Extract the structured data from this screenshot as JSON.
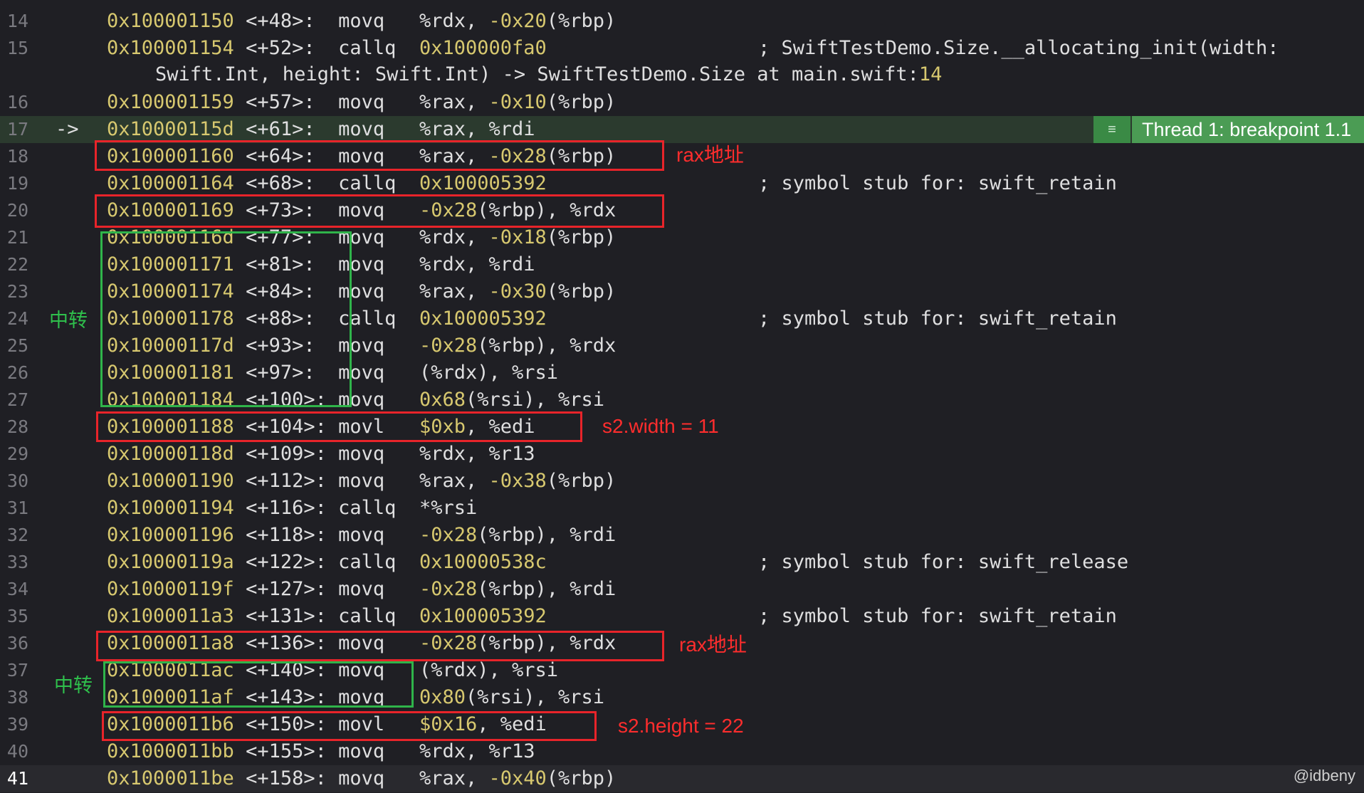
{
  "lines": [
    {
      "n": "14",
      "addr": "0x100001150",
      "off": "<+48>:",
      "op": "movq",
      "args": "%rdx, -0x20(%rbp)",
      "comment": ""
    },
    {
      "n": "15",
      "addr": "0x100001154",
      "off": "<+52>:",
      "op": "callq",
      "args": "0x100000fa0",
      "comment": "; SwiftTestDemo.Size.__allocating_init(width:"
    },
    {
      "n": "16",
      "addr": "0x100001159",
      "off": "<+57>:",
      "op": "movq",
      "args": "%rax, -0x10(%rbp)",
      "comment": ""
    },
    {
      "n": "17",
      "addr": "0x10000115d",
      "off": "<+61>:",
      "op": "movq",
      "args": "%rax, %rdi",
      "comment": ""
    },
    {
      "n": "18",
      "addr": "0x100001160",
      "off": "<+64>:",
      "op": "movq",
      "args": "%rax, -0x28(%rbp)",
      "comment": ""
    },
    {
      "n": "19",
      "addr": "0x100001164",
      "off": "<+68>:",
      "op": "callq",
      "args": "0x100005392",
      "comment": "; symbol stub for: swift_retain"
    },
    {
      "n": "20",
      "addr": "0x100001169",
      "off": "<+73>:",
      "op": "movq",
      "args": "-0x28(%rbp), %rdx",
      "comment": ""
    },
    {
      "n": "21",
      "addr": "0x10000116d",
      "off": "<+77>:",
      "op": "movq",
      "args": "%rdx, -0x18(%rbp)",
      "comment": ""
    },
    {
      "n": "22",
      "addr": "0x100001171",
      "off": "<+81>:",
      "op": "movq",
      "args": "%rdx, %rdi",
      "comment": ""
    },
    {
      "n": "23",
      "addr": "0x100001174",
      "off": "<+84>:",
      "op": "movq",
      "args": "%rax, -0x30(%rbp)",
      "comment": ""
    },
    {
      "n": "24",
      "addr": "0x100001178",
      "off": "<+88>:",
      "op": "callq",
      "args": "0x100005392",
      "comment": "; symbol stub for: swift_retain"
    },
    {
      "n": "25",
      "addr": "0x10000117d",
      "off": "<+93>:",
      "op": "movq",
      "args": "-0x28(%rbp), %rdx",
      "comment": ""
    },
    {
      "n": "26",
      "addr": "0x100001181",
      "off": "<+97>:",
      "op": "movq",
      "args": "(%rdx), %rsi",
      "comment": ""
    },
    {
      "n": "27",
      "addr": "0x100001184",
      "off": "<+100>:",
      "op": "movq",
      "args": "0x68(%rsi), %rsi",
      "comment": ""
    },
    {
      "n": "28",
      "addr": "0x100001188",
      "off": "<+104>:",
      "op": "movl",
      "args": "$0xb, %edi",
      "comment": ""
    },
    {
      "n": "29",
      "addr": "0x10000118d",
      "off": "<+109>:",
      "op": "movq",
      "args": "%rdx, %r13",
      "comment": ""
    },
    {
      "n": "30",
      "addr": "0x100001190",
      "off": "<+112>:",
      "op": "movq",
      "args": "%rax, -0x38(%rbp)",
      "comment": ""
    },
    {
      "n": "31",
      "addr": "0x100001194",
      "off": "<+116>:",
      "op": "callq",
      "args": "*%rsi",
      "comment": ""
    },
    {
      "n": "32",
      "addr": "0x100001196",
      "off": "<+118>:",
      "op": "movq",
      "args": "-0x28(%rbp), %rdi",
      "comment": ""
    },
    {
      "n": "33",
      "addr": "0x10000119a",
      "off": "<+122>:",
      "op": "callq",
      "args": "0x10000538c",
      "comment": "; symbol stub for: swift_release"
    },
    {
      "n": "34",
      "addr": "0x10000119f",
      "off": "<+127>:",
      "op": "movq",
      "args": "-0x28(%rbp), %rdi",
      "comment": ""
    },
    {
      "n": "35",
      "addr": "0x1000011a3",
      "off": "<+131>:",
      "op": "callq",
      "args": "0x100005392",
      "comment": "; symbol stub for: swift_retain"
    },
    {
      "n": "36",
      "addr": "0x1000011a8",
      "off": "<+136>:",
      "op": "movq",
      "args": "-0x28(%rbp), %rdx",
      "comment": ""
    },
    {
      "n": "37",
      "addr": "0x1000011ac",
      "off": "<+140>:",
      "op": "movq",
      "args": "(%rdx), %rsi",
      "comment": ""
    },
    {
      "n": "38",
      "addr": "0x1000011af",
      "off": "<+143>:",
      "op": "movq",
      "args": "0x80(%rsi), %rsi",
      "comment": ""
    },
    {
      "n": "39",
      "addr": "0x1000011b6",
      "off": "<+150>:",
      "op": "movl",
      "args": "$0x16, %edi",
      "comment": ""
    },
    {
      "n": "40",
      "addr": "0x1000011bb",
      "off": "<+155>:",
      "op": "movq",
      "args": "%rdx, %r13",
      "comment": ""
    },
    {
      "n": "41",
      "addr": "0x1000011be",
      "off": "<+158>:",
      "op": "movq",
      "args": "%rax, -0x40(%rbp)",
      "comment": ""
    }
  ],
  "continuation": {
    "text": "Swift.Int, height: Swift.Int) -> SwiftTestDemo.Size at main.swift:",
    "line_ref": "14"
  },
  "current_line": {
    "number": "17",
    "marker": "->"
  },
  "thread_badge": {
    "menu_icon": "list-icon",
    "label": "Thread 1: breakpoint 1.1"
  },
  "annotations": {
    "rax_addr_1": "rax地址",
    "rax_addr_2": "rax地址",
    "relay_1": "中转",
    "relay_2": "中转",
    "width_note": "s2.width = 11",
    "height_note": "s2.height = 22"
  },
  "watermark": "@idbeny",
  "colors": {
    "annotation_red": "#ff2d2d",
    "annotation_green": "#2fc04c",
    "address": "#d7c86f",
    "current_line_bg": "#2b3a2e",
    "badge_bg": "#4b9c54"
  }
}
